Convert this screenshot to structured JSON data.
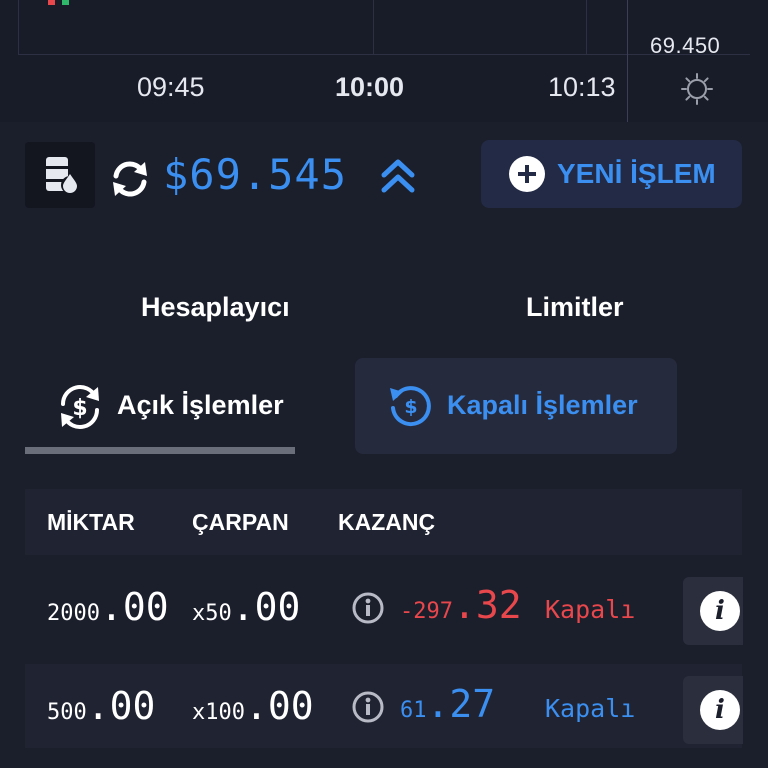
{
  "chart": {
    "price_tag": "69.450",
    "times": [
      "09:45",
      "10:00",
      "10:13"
    ]
  },
  "asset": {
    "price": "$69.545"
  },
  "new_trade": {
    "label": "YENİ İŞLEM"
  },
  "tabs": {
    "calculator": "Hesaplayıcı",
    "limits": "Limitler"
  },
  "subtabs": {
    "open": "Açık İşlemler",
    "closed": "Kapalı İşlemler"
  },
  "table": {
    "headers": [
      "MİKTAR",
      "ÇARPAN",
      "KAZANÇ"
    ],
    "rows": [
      {
        "amount_int": "2000",
        "amount_dec": ".00",
        "mult_prefix": "x50",
        "mult_dec": ".00",
        "profit_int": "-297",
        "profit_dec": ".32",
        "profit_sign": "negative",
        "status": "Kapalı"
      },
      {
        "amount_int": "500",
        "amount_dec": ".00",
        "mult_prefix": "x100",
        "mult_dec": ".00",
        "profit_int": "61",
        "profit_dec": ".27",
        "profit_sign": "positive",
        "status": "Kapalı"
      }
    ]
  },
  "colors": {
    "accent": "#3b8ff0",
    "negative": "#e8474c",
    "background": "#1b1e2b"
  },
  "icons": [
    "settings-icon",
    "oil-barrel-icon",
    "refresh-icon",
    "double-chevron-up-icon",
    "plus-icon",
    "open-trades-icon",
    "closed-trades-icon",
    "info-icon"
  ]
}
